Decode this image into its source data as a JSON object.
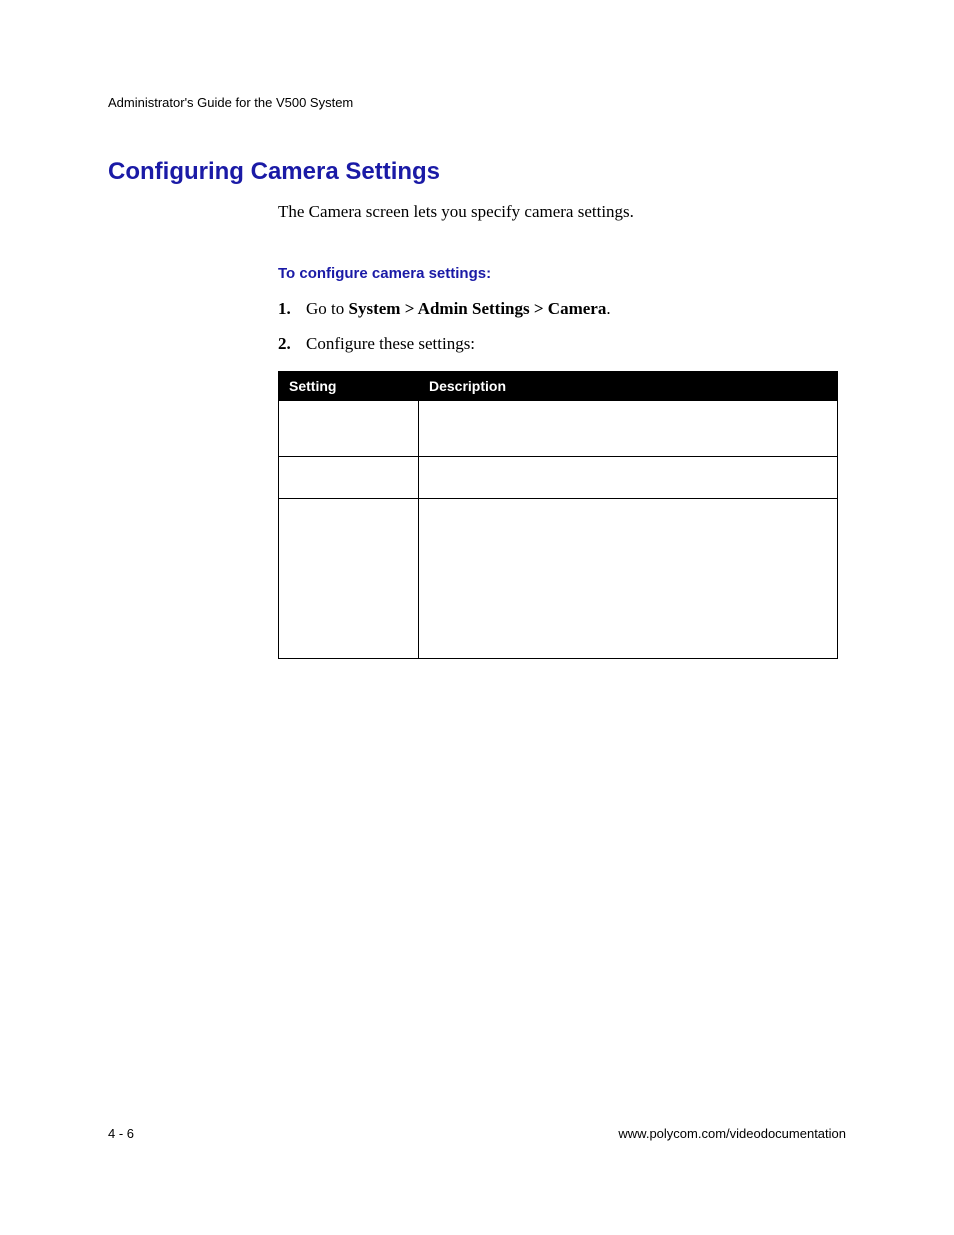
{
  "running_head": "Administrator's Guide for the V500 System",
  "section_title": "Configuring Camera Settings",
  "intro": "The Camera screen lets you specify camera settings.",
  "subhead": "To configure camera settings:",
  "steps": [
    {
      "num": "1.",
      "prefix": "Go to ",
      "bold": "System > Admin Settings > Camera",
      "suffix": "."
    },
    {
      "num": "2.",
      "prefix": "Configure these settings:",
      "bold": "",
      "suffix": ""
    }
  ],
  "table": {
    "headers": [
      "Setting",
      "Description"
    ],
    "rows": [
      {
        "setting": "",
        "description": ""
      },
      {
        "setting": "",
        "description": ""
      },
      {
        "setting": "",
        "description": ""
      }
    ]
  },
  "footer": {
    "page": "4 - 6",
    "url": "www.polycom.com/videodocumentation"
  }
}
